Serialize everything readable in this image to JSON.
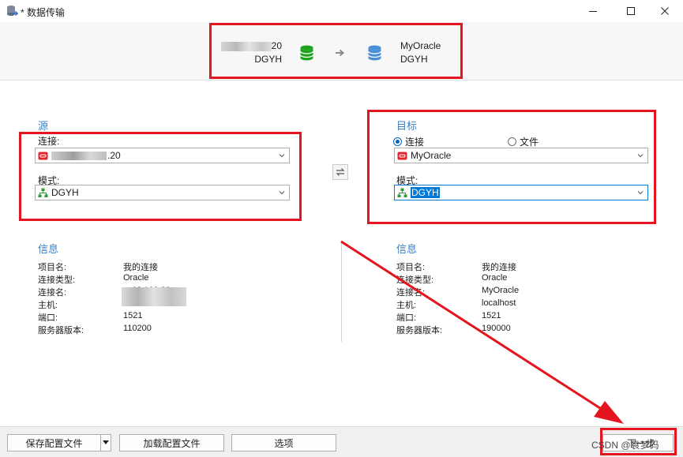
{
  "window": {
    "title": "* 数据传输",
    "controls": [
      "minimize",
      "maximize",
      "close"
    ]
  },
  "header": {
    "source": {
      "connection_suffix": "20",
      "schema": "DGYH"
    },
    "target": {
      "connection": "MyOracle",
      "schema": "DGYH"
    },
    "colors": {
      "source_db": "#1ea21e",
      "target_db": "#4a90d9"
    }
  },
  "source": {
    "title": "源",
    "connection_label": "连接:",
    "connection_value_suffix": ".20",
    "schema_label": "模式:",
    "schema_value": "DGYH"
  },
  "target": {
    "title": "目标",
    "radio_connection": "连接",
    "radio_file": "文件",
    "selected_radio": "连接",
    "connection_value": "MyOracle",
    "schema_label": "模式:",
    "schema_value": "DGYH"
  },
  "source_info": {
    "title": "信息",
    "rows": [
      {
        "label": "项目名:",
        "value": "我的连接"
      },
      {
        "label": "连接类型:",
        "value": "Oracle"
      },
      {
        "label": "连接名:",
        "value": "…03.103.20"
      },
      {
        "label": "主机:",
        "value": ""
      },
      {
        "label": "端口:",
        "value": "1521"
      },
      {
        "label": "服务器版本:",
        "value": "110200"
      }
    ]
  },
  "target_info": {
    "title": "信息",
    "rows": [
      {
        "label": "项目名:",
        "value": "我的连接"
      },
      {
        "label": "连接类型:",
        "value": "Oracle"
      },
      {
        "label": "连接名:",
        "value": "MyOracle"
      },
      {
        "label": "主机:",
        "value": "localhost"
      },
      {
        "label": "端口:",
        "value": "1521"
      },
      {
        "label": "服务器版本:",
        "value": "190000"
      }
    ]
  },
  "footer": {
    "save_config": "保存配置文件",
    "load_config": "加载配置文件",
    "options": "选项",
    "next": "下一步"
  },
  "watermark": "CSDN @袁梦码",
  "annotations": {
    "highlight_color": "#e5151f"
  }
}
